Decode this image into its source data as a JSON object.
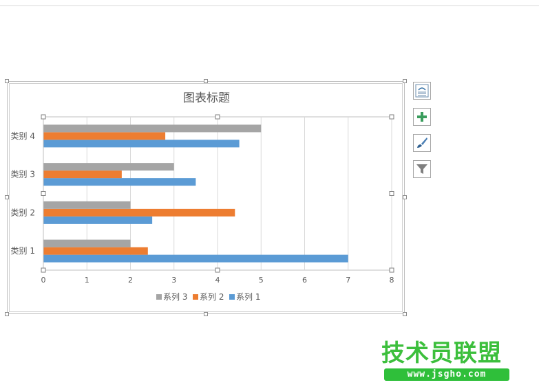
{
  "chart_data": {
    "type": "bar",
    "orientation": "horizontal",
    "title": "图表标题",
    "categories": [
      "类别 1",
      "类别 2",
      "类别 3",
      "类别 4"
    ],
    "series": [
      {
        "name": "系列 1",
        "color": "#5b9bd5",
        "values": [
          7,
          2.5,
          3.5,
          4.5
        ]
      },
      {
        "name": "系列 2",
        "color": "#ed7d31",
        "values": [
          2.4,
          4.4,
          1.8,
          2.8
        ]
      },
      {
        "name": "系列 3",
        "color": "#a5a5a5",
        "values": [
          2,
          2,
          3,
          5
        ]
      }
    ],
    "xlim": [
      0,
      8
    ],
    "xticks": [
      0,
      1,
      2,
      3,
      4,
      5,
      6,
      7,
      8
    ],
    "grid": true,
    "legend_position": "bottom"
  },
  "side_buttons": [
    {
      "name": "layout-icon"
    },
    {
      "name": "add-element-icon"
    },
    {
      "name": "style-brush-icon"
    },
    {
      "name": "filter-icon"
    }
  ],
  "watermark": {
    "title": "技术员联盟",
    "url": "www.jsgho.com"
  }
}
